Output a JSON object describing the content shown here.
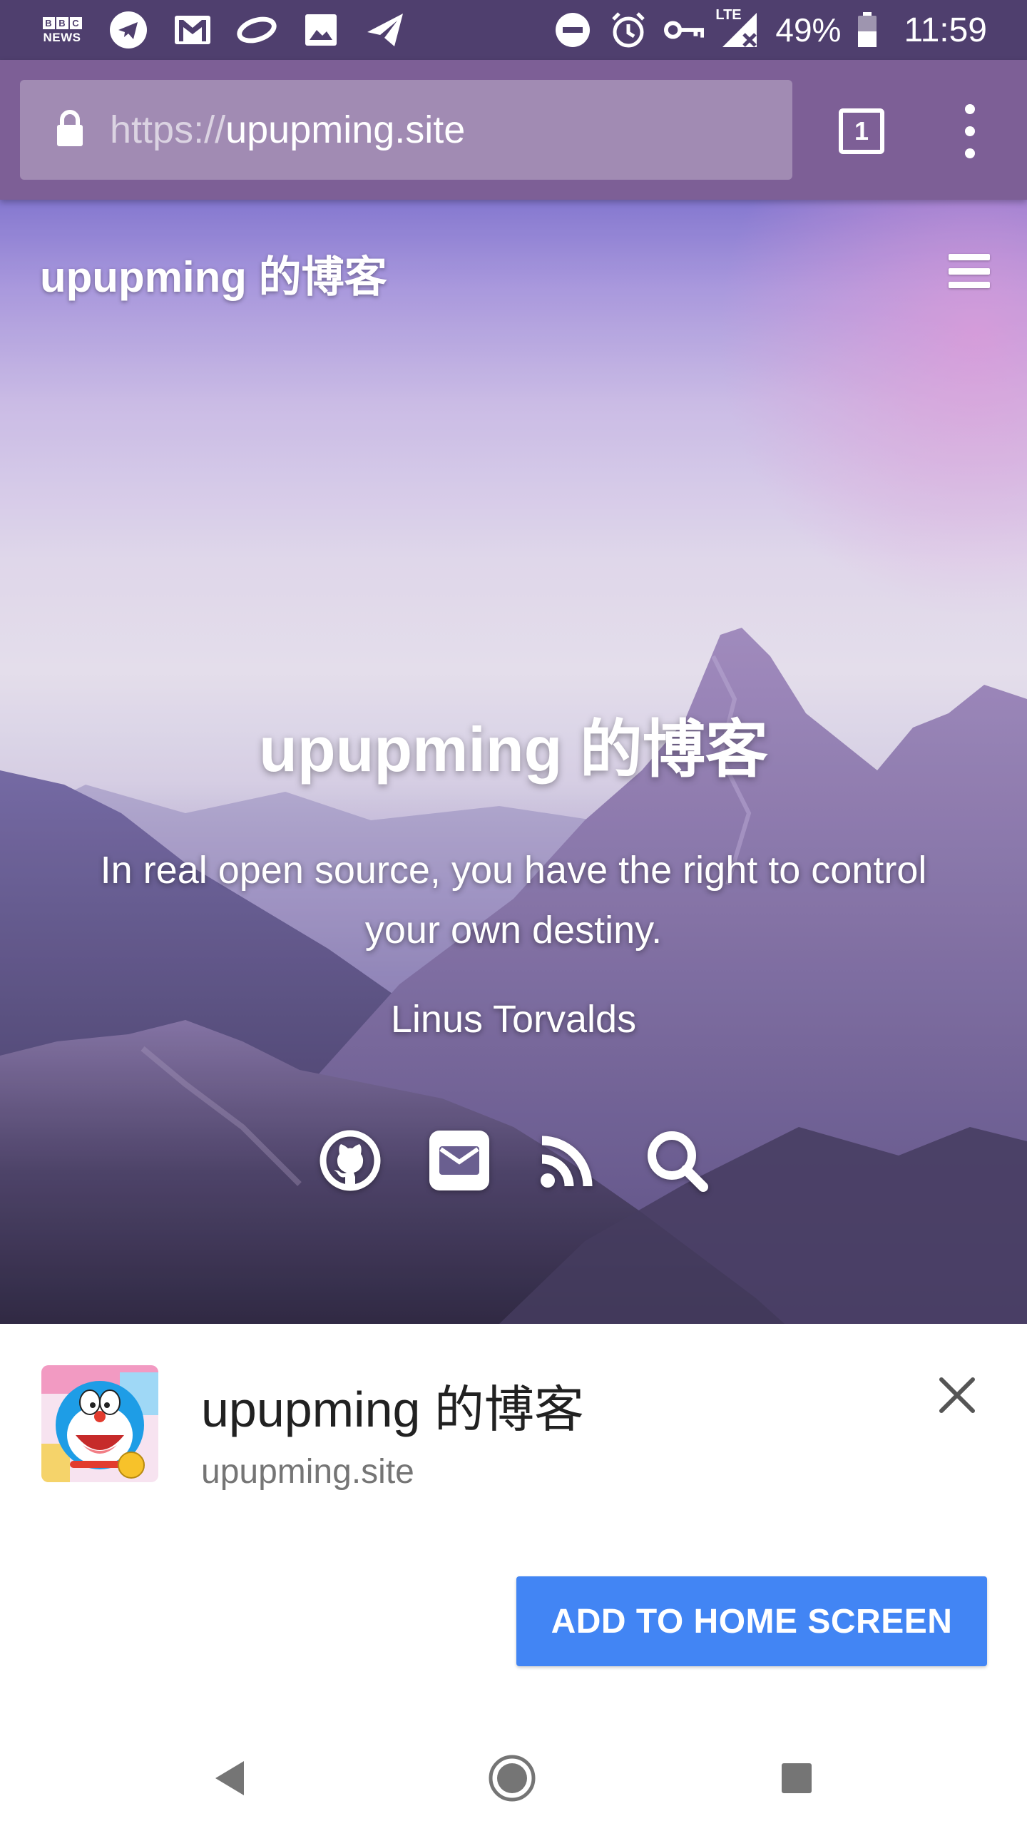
{
  "status_bar": {
    "bbc_letters": [
      "B",
      "B",
      "C"
    ],
    "bbc_news": "NEWS",
    "network": "LTE",
    "battery": "49%",
    "time": "11:59",
    "left_icons": [
      "bbc-news-icon",
      "telegram-icon",
      "gmail-icon",
      "link-app-icon",
      "photos-icon",
      "send-icon"
    ],
    "right_icons": [
      "do-not-disturb-icon",
      "alarm-icon",
      "vpn-key-icon",
      "signal-icon",
      "battery-icon"
    ]
  },
  "toolbar": {
    "url_scheme": "https://",
    "url_host": "upupming.site",
    "tab_count": "1"
  },
  "hero": {
    "brand": "upupming 的博客",
    "title": "upupming 的博客",
    "quote": "In real open source, you have the right to control your own destiny.",
    "author": "Linus Torvalds",
    "social_icons": [
      "github-icon",
      "mail-icon",
      "rss-icon",
      "search-icon"
    ]
  },
  "install_banner": {
    "app_name": "upupming 的博客",
    "app_url": "upupming.site",
    "add_label": "ADD TO HOME SCREEN",
    "accent": "#4285f4"
  },
  "navbar": {
    "buttons": [
      "back-icon",
      "home-icon",
      "recents-icon"
    ]
  },
  "colors": {
    "status_bar": "#4f3f6e",
    "toolbar": "#7d5f96"
  }
}
